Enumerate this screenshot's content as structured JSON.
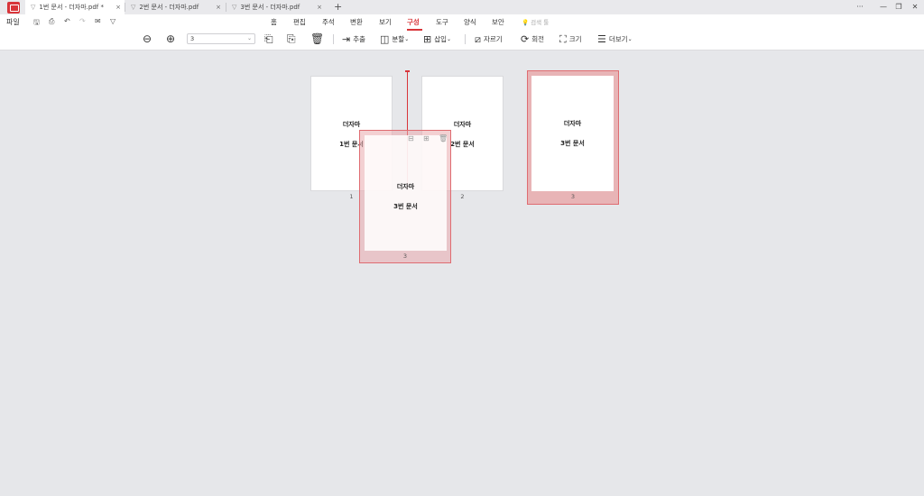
{
  "tabs": [
    {
      "label": "1번 문서 - 더자마.pdf *",
      "active": true
    },
    {
      "label": "2번 문서 - 더자마.pdf",
      "active": false
    },
    {
      "label": "3번 문서 - 더자마.pdf",
      "active": false
    }
  ],
  "tab_close": "×",
  "new_tab": "+",
  "window_controls": {
    "more": "···",
    "minimize": "—",
    "restore": "❐",
    "close": "✕"
  },
  "file_menu": "파일",
  "menu": [
    "홈",
    "편집",
    "주석",
    "변환",
    "보기",
    "구성",
    "도구",
    "양식",
    "보안"
  ],
  "active_menu": "구성",
  "search_hint": "검색 툴",
  "zoom": {
    "value": "3"
  },
  "toolbar": {
    "extract": "추출",
    "split": "분할",
    "insert": "삽입",
    "crop": "자르기",
    "rotate": "회전",
    "size": "크기",
    "more": "더보기"
  },
  "pages": [
    {
      "title": "더자마",
      "subtitle": "1번 문서",
      "number": "1"
    },
    {
      "title": "더자마",
      "subtitle": "2번 문서",
      "number": "2"
    },
    {
      "title": "더자마",
      "subtitle": "3번 문서",
      "number": "3"
    }
  ],
  "drag_ghost": {
    "title": "더자마",
    "subtitle": "3번 문서",
    "number": "3"
  },
  "colors": {
    "accent": "#d8353a",
    "selection": "#e8b4b6",
    "canvas": "#e6e7ea"
  }
}
